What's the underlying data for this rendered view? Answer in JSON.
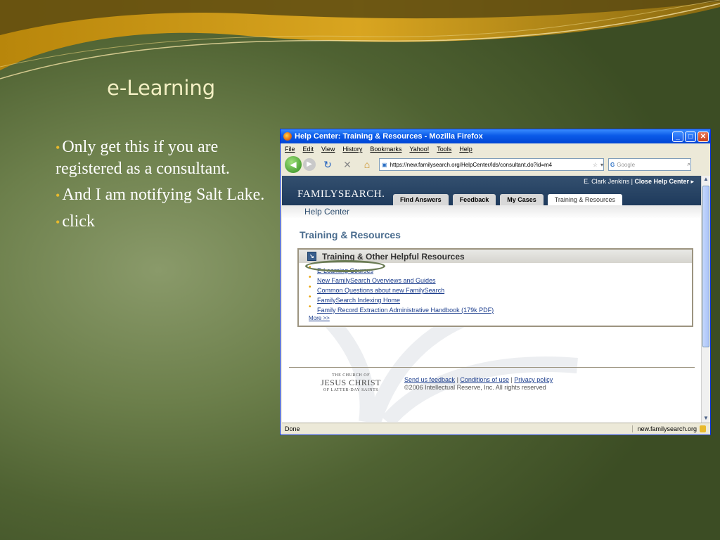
{
  "slide": {
    "title": "e-Learning",
    "bullets": [
      "Only get this if you are registered as a consultant.",
      "And I am notifying Salt Lake.",
      "click"
    ]
  },
  "browser": {
    "window_title": "Help Center: Training & Resources - Mozilla Firefox",
    "menu": [
      "File",
      "Edit",
      "View",
      "History",
      "Bookmarks",
      "Yahoo!",
      "Tools",
      "Help"
    ],
    "url": "https://new.familysearch.org/HelpCenter/lds/consultant.do?id=m4",
    "search_placeholder": "Google",
    "status_text": "Done",
    "status_host": "new.familysearch.org"
  },
  "page": {
    "user_name": "E. Clark Jenkins",
    "close_link": "Close Help Center",
    "logo_text": "FAMILYSEARCH.",
    "tabs": [
      "Find Answers",
      "Feedback",
      "My Cases",
      "Training & Resources"
    ],
    "active_tab": "Training & Resources",
    "subheader": "Help Center",
    "heading": "Training & Resources",
    "box_title": "Training & Other Helpful Resources",
    "links": [
      "E-Learning Courses",
      "New FamilySearch Overviews and Guides",
      "Common Questions about new FamilySearch",
      "FamilySearch Indexing Home",
      "Family Record Extraction Administrative Handbook (179k PDF)"
    ],
    "more_link": "More >>",
    "church_line1": "THE CHURCH OF",
    "church_line2": "JESUS CHRIST",
    "church_line3": "OF LATTER-DAY SAINTS",
    "footer_links": [
      "Send us feedback",
      "Conditions of use",
      "Privacy policy"
    ],
    "copyright": "©2006 Intellectual Reserve, Inc. All rights reserved"
  },
  "colors": {
    "accent_bullet": "#e8b92c",
    "title_color": "#f4f0c4",
    "link_color": "#1a3c8c",
    "header_blue": "#1e3a5c"
  }
}
